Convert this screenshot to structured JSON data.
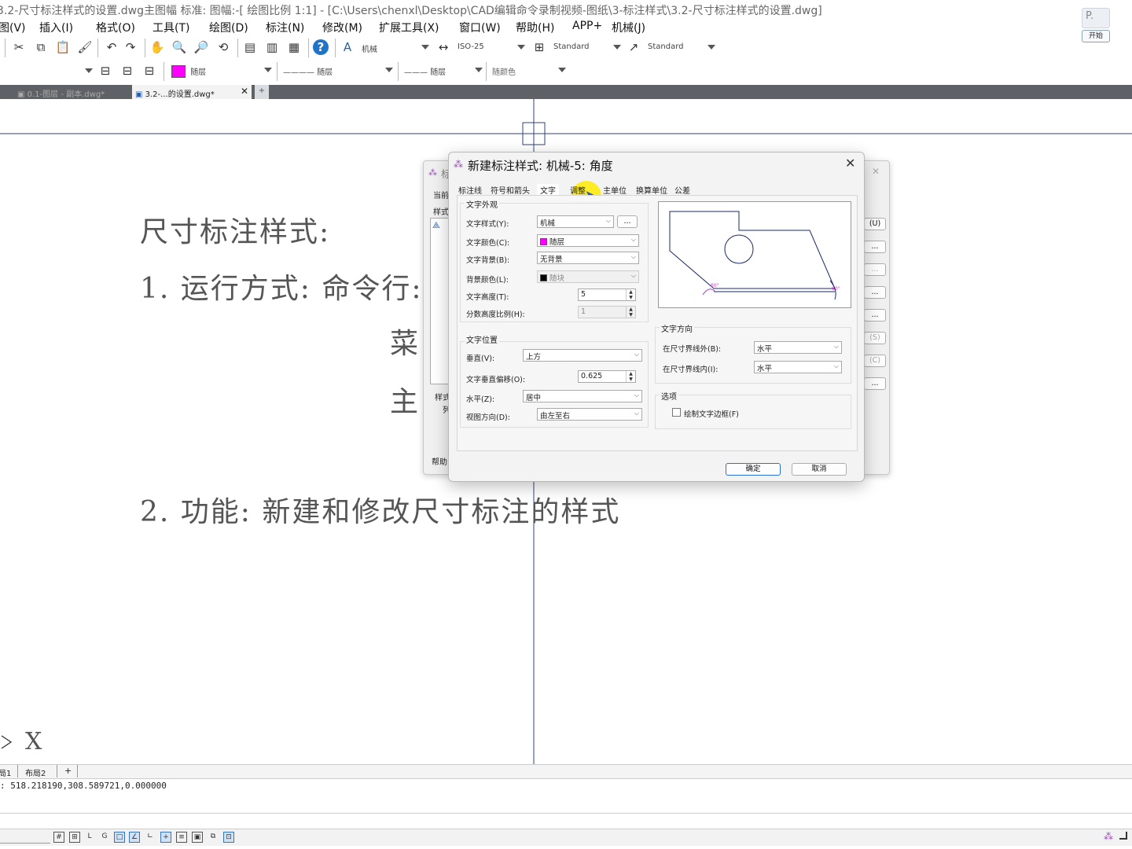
{
  "window": {
    "title": "3.2-尺寸标注样式的设置.dwg主图幅  标准: 图幅:-[ 绘图比例 1:1] - [C:\\Users\\chenxl\\Desktop\\CAD编辑命令录制视频-图纸\\3-标注样式\\3.2-尺寸标注样式的设置.dwg]",
    "p_button": "P.",
    "open_button": "开始"
  },
  "menu": [
    "图(V)",
    "插入(I)",
    "格式(O)",
    "工具(T)",
    "绘图(D)",
    "标注(N)",
    "修改(M)",
    "扩展工具(X)",
    "窗口(W)",
    "帮助(H)",
    "APP+",
    "机械(J)"
  ],
  "toolbar": {
    "text_style": "机械",
    "dim_style": "ISO-25",
    "table_style": "Standard",
    "multileader_style": "Standard",
    "layer_color": "随层",
    "linetype": "随层",
    "lineweight": "随层",
    "plot_style": "随颜色",
    "layer_color_hex": "#ff00ff"
  },
  "doc_tabs": [
    {
      "label": "0.1-图层 - 副本.dwg*",
      "active": false
    },
    {
      "label": "3.2-...的设置.dwg*",
      "active": true
    }
  ],
  "canvas_text": {
    "line1": "尺寸标注样式:",
    "line2": "1. 运行方式:  命令行: D",
    "line3": "菜",
    "line4": "主",
    "line5": "2. 功能: 新建和修改尺寸标注的样式",
    "axis_x": "X"
  },
  "back_dialog": {
    "title_fragment": "标",
    "current_label": "当前",
    "styles_label": "样式",
    "list_label": "样式",
    "list_sub": "列",
    "help": "帮助",
    "buttons": [
      "(U)",
      "...",
      "...",
      "...",
      "...",
      "(S)",
      "(C)",
      "..."
    ]
  },
  "dialog": {
    "title": "新建标注样式: 机械-5: 角度",
    "tabs": [
      "标注线",
      "符号和箭头",
      "文字",
      "调整",
      "主单位",
      "换算单位",
      "公差"
    ],
    "active_tab": "文字",
    "text_appearance": {
      "group": "文字外观",
      "style_label": "文字样式(Y):",
      "style_value": "机械",
      "style_btn": "...",
      "color_label": "文字颜色(C):",
      "color_value": "随层",
      "color_hex": "#ff00ff",
      "fill_label": "文字背景(B):",
      "fill_value": "无背景",
      "bgcolor_label": "背景颜色(L):",
      "bgcolor_value": "随块",
      "bgcolor_hex": "#000000",
      "height_label": "文字高度(T):",
      "height_value": "5",
      "fraction_label": "分数高度比例(H):",
      "fraction_value": "1"
    },
    "text_placement": {
      "group": "文字位置",
      "vertical_label": "垂直(V):",
      "vertical_value": "上方",
      "offset_label": "文字垂直偏移(O):",
      "offset_value": "0.625",
      "horizontal_label": "水平(Z):",
      "horizontal_value": "居中",
      "view_label": "视图方向(D):",
      "view_value": "由左至右"
    },
    "text_alignment": {
      "group": "文字方向",
      "outside_label": "在尺寸界线外(B):",
      "outside_value": "水平",
      "inside_label": "在尺寸界线内(I):",
      "inside_value": "水平"
    },
    "options": {
      "group": "选项",
      "frame_label": "绘制文字边框(F)"
    },
    "ok": "确定",
    "cancel": "取消"
  },
  "layout_tabs": [
    "局1",
    "布局2",
    "+"
  ],
  "command_line": ": 518.218190,308.589721,0.000000"
}
